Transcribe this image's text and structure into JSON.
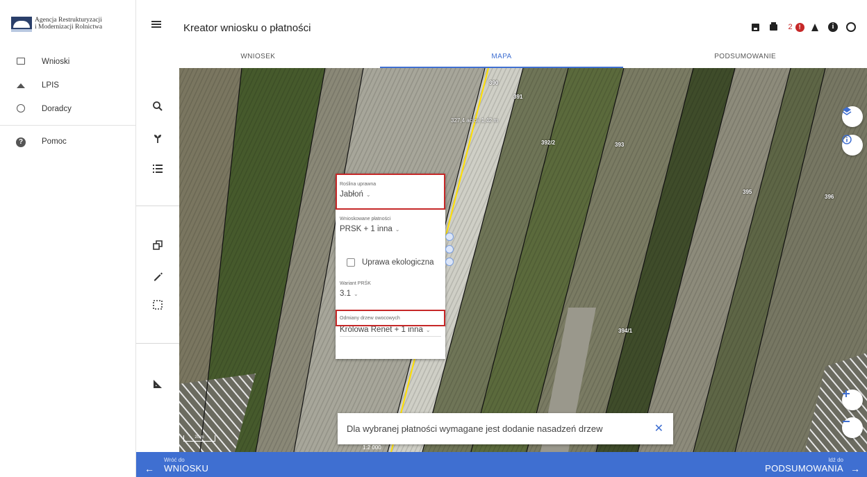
{
  "brand": {
    "line1": "Agencja Restrukturyzacji",
    "line2": "i Modernizacji Rolnictwa"
  },
  "sidebar": {
    "items": [
      {
        "label": "Wnioski",
        "icon": "tray-icon"
      },
      {
        "label": "LPIS",
        "icon": "mountain-icon"
      },
      {
        "label": "Doradcy",
        "icon": "face-icon"
      },
      {
        "label": "Pomoc",
        "icon": "help-icon"
      }
    ]
  },
  "header": {
    "title": "Kreator wniosku o płatności",
    "notification_count": "2",
    "alert_mark": "!",
    "info_mark": "i"
  },
  "tabs": [
    {
      "label": "WNIOSEK",
      "active": false
    },
    {
      "label": "MAPA",
      "active": true
    },
    {
      "label": "PODSUMOWANIE",
      "active": false
    }
  ],
  "map": {
    "parcels": [
      "390",
      "391",
      "392/2",
      "393",
      "395",
      "396",
      "394/1"
    ],
    "measure_text": "327,4 ac ca 1,42 m",
    "scale_bar": "20 m",
    "scale_ratio": "1:2 000"
  },
  "popup": {
    "crop_label": "Roślina uprawna",
    "crop_value": "Jabłoń",
    "payments_label": "Wnioskowane płatności",
    "payments_value": "PRSK + 1 inna",
    "organic_label": "Uprawa ekologiczna",
    "variant_label": "Wariant PRŚK",
    "variant_value": "3.1",
    "varieties_label": "Odmiany drzew owocowych",
    "varieties_value": "Królowa Renet + 1 inna",
    "caret": "⌄"
  },
  "snackbar": {
    "message": "Dla wybranej płatności wymagane jest dodanie nasadzeń drzew",
    "close": "✕"
  },
  "footer": {
    "back_small": "Wróć do",
    "back_big": "WNIOSKU",
    "next_small": "Idź do",
    "next_big": "PODSUMOWANIA",
    "back_arrow": "←",
    "next_arrow": "→"
  },
  "colors": {
    "accent": "#3f6fd1",
    "highlight": "#c62828",
    "alert": "#c62828"
  }
}
